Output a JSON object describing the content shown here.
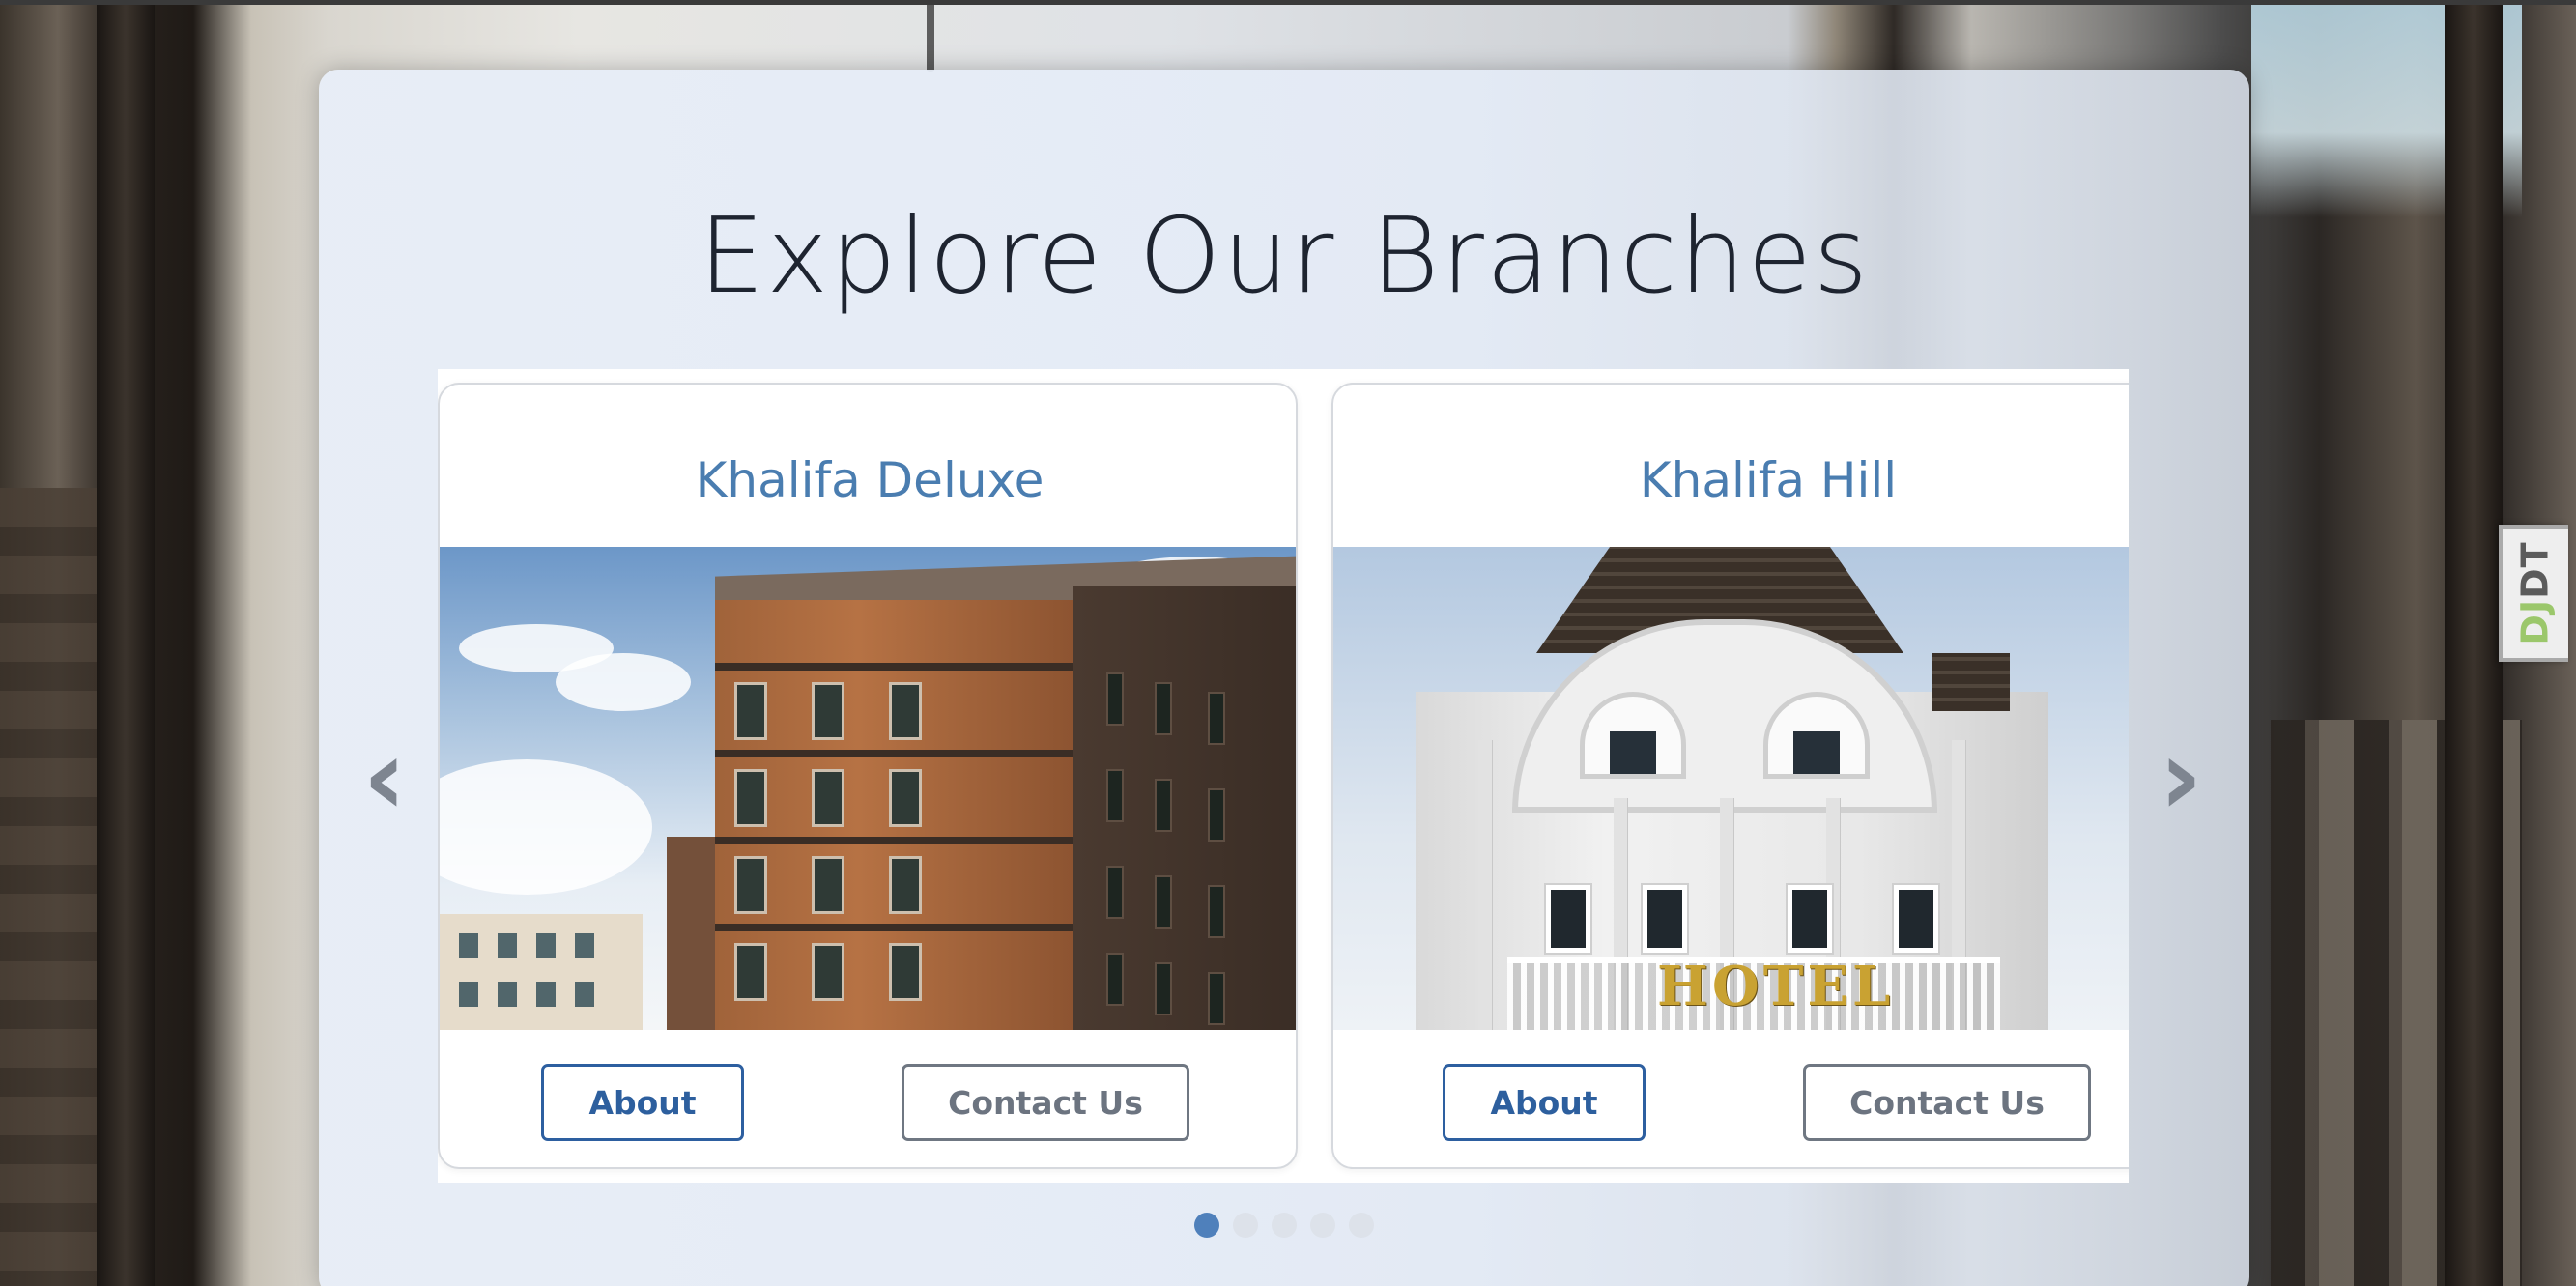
{
  "page": {
    "title": "Explore Our Branches"
  },
  "carousel": {
    "cards": [
      {
        "name": "Khalifa Deluxe",
        "about_label": "About",
        "contact_label": "Contact Us"
      },
      {
        "name": "Khalifa Hill",
        "about_label": "About",
        "contact_label": "Contact Us"
      }
    ],
    "prev_label": "‹",
    "next_label": "›",
    "dots_total": 5,
    "active_dot": 1
  },
  "hotel_sign": "HOTEL",
  "debug_toolbar": {
    "label_dj": "DJ",
    "label_dt": "DT"
  },
  "colors": {
    "accent": "#4a7db0",
    "button_primary": "#2d5fa0",
    "button_secondary": "#6f7782",
    "dot_active": "#4f80bb",
    "dot_inactive": "#dde2ea"
  }
}
